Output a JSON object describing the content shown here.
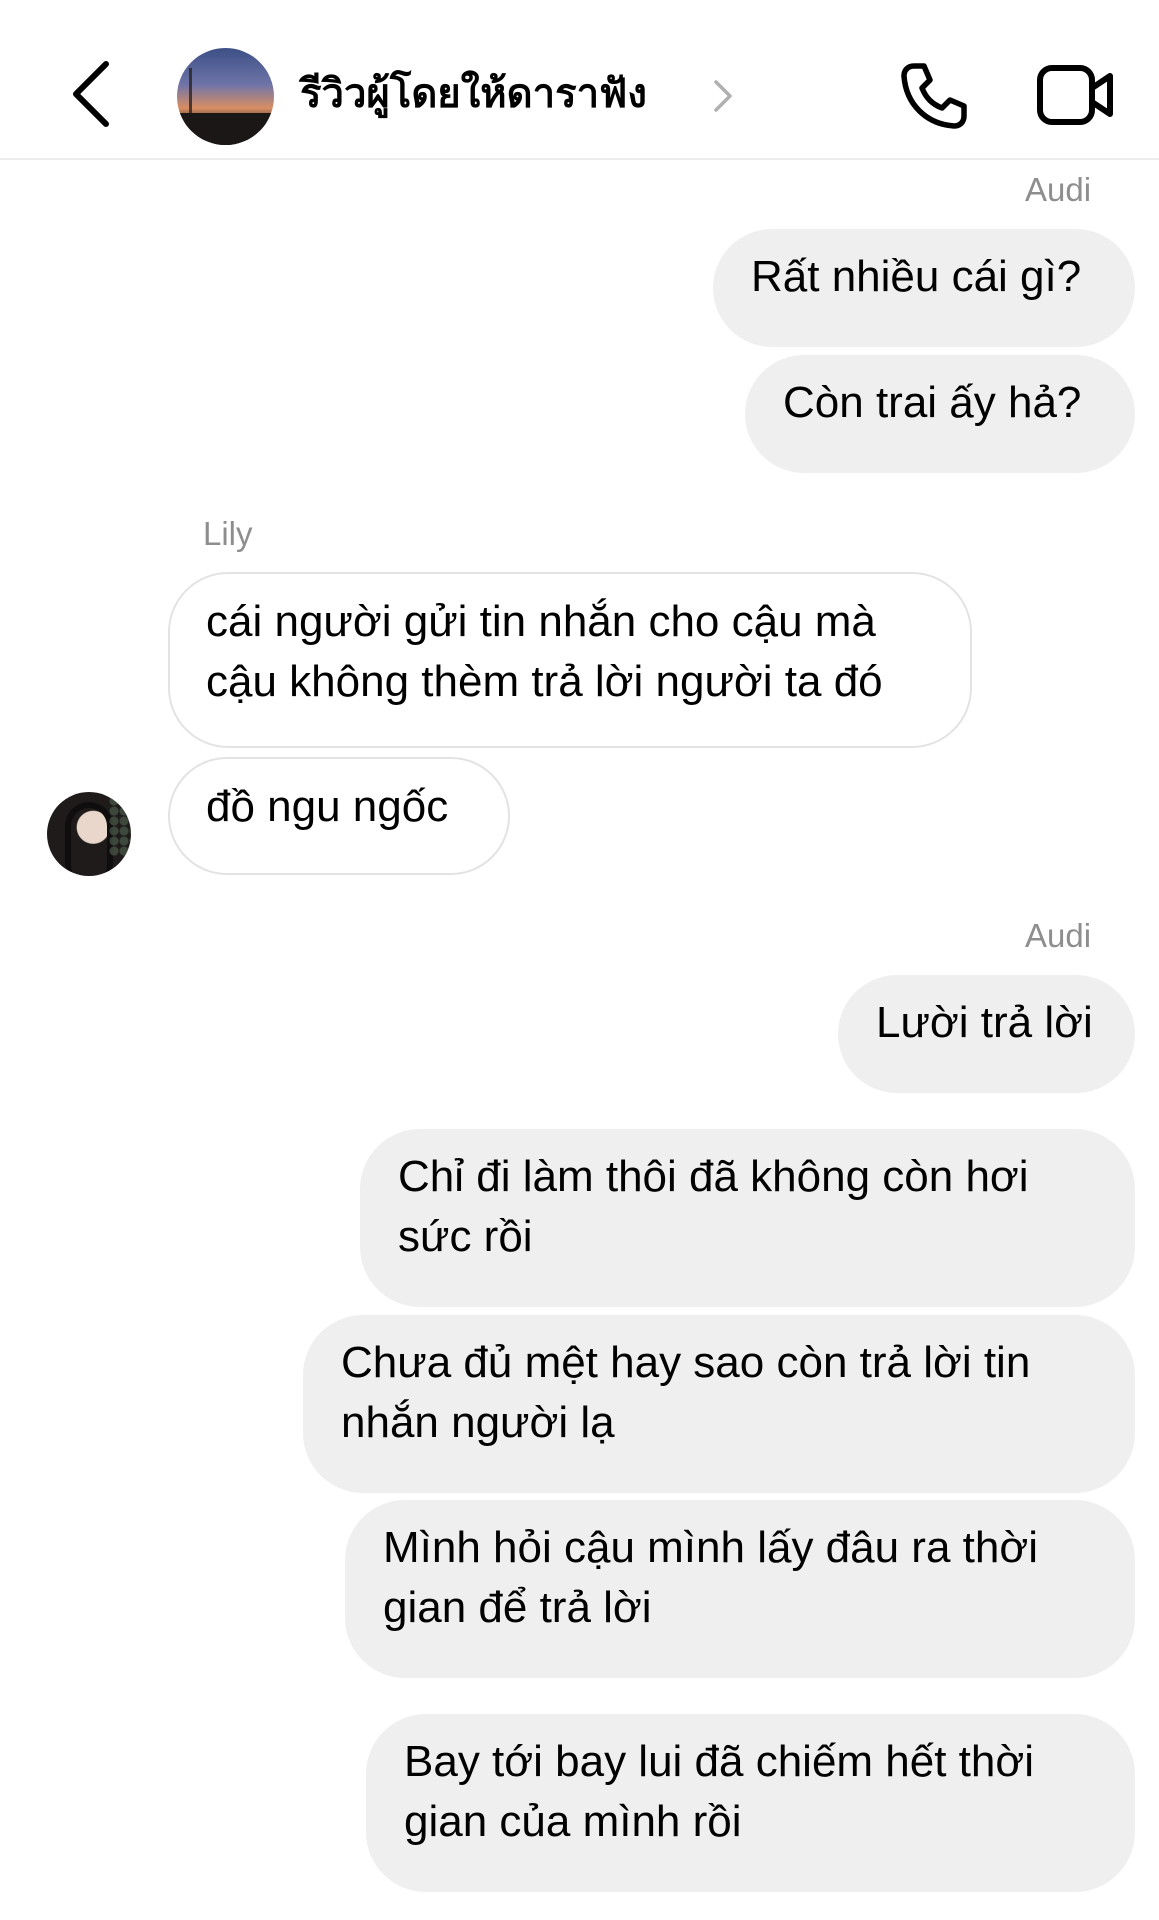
{
  "header": {
    "title": "รีวิวผู้โดยให้ดาราฟัง",
    "icons": {
      "back": "chevron-left-icon",
      "title_chevron": "chevron-right-icon",
      "call": "phone-icon",
      "video": "video-camera-icon"
    }
  },
  "messages": [
    {
      "sender": "Audi",
      "text": "Rất nhiều cái gì?",
      "direction": "outgoing"
    },
    {
      "sender": "Audi",
      "text": "Còn trai ấy hả?",
      "direction": "outgoing"
    },
    {
      "sender": "Lily",
      "text": "cái người gửi tin nhắn cho cậu mà\ncậu không thèm trả lời người ta đó",
      "direction": "incoming"
    },
    {
      "sender": "Lily",
      "text": "đồ ngu ngốc",
      "direction": "incoming"
    },
    {
      "sender": "Audi",
      "text": "Lười trả lời",
      "direction": "outgoing"
    },
    {
      "sender": "Audi",
      "text": "Chỉ đi làm thôi đã không còn hơi\nsức rồi",
      "direction": "outgoing"
    },
    {
      "sender": "Audi",
      "text": "Chưa đủ mệt hay sao còn trả lời tin\nnhắn người lạ",
      "direction": "outgoing"
    },
    {
      "sender": "Audi",
      "text": "Mình hỏi cậu mình lấy đâu ra thời\ngian để trả lời",
      "direction": "outgoing"
    },
    {
      "sender": "Audi",
      "text": "Bay tới bay lui đã chiếm hết thời\ngian của mình rồi",
      "direction": "outgoing"
    }
  ],
  "sender_labels": [
    "Audi",
    "Lily",
    "Audi"
  ],
  "colors": {
    "outgoing_bubble": "#efefef",
    "incoming_border": "#e3e3e3",
    "sender_name": "#8e8e8e",
    "divider": "#ececec"
  }
}
